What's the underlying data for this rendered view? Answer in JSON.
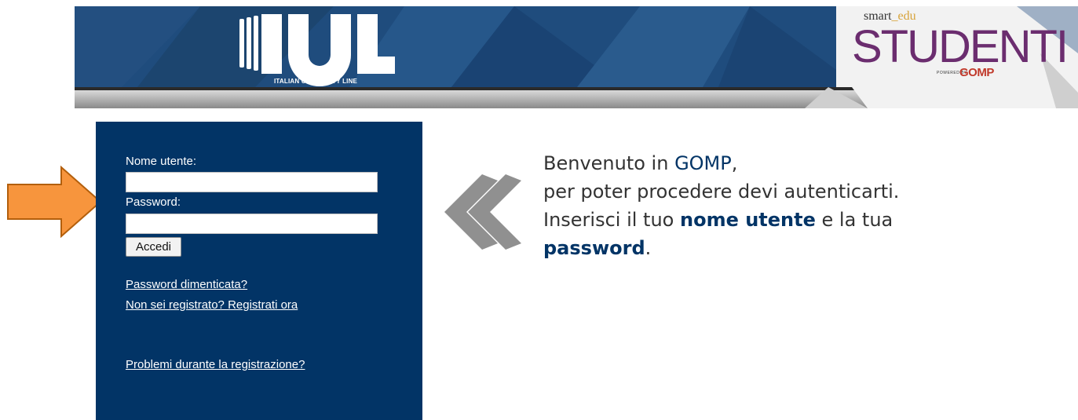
{
  "header": {
    "left_logo_text": "IUL",
    "left_logo_tagline": "ITALIAN UNIVERSITY LINE",
    "right_logo": {
      "smart": "smart",
      "sep": "_",
      "edu": "edu",
      "title": "STUDENTI",
      "powered_by": "POWERED BY",
      "gomp": "GOMP"
    }
  },
  "login": {
    "username_label": "Nome utente:",
    "username_value": "",
    "password_label": "Password:",
    "password_value": "",
    "submit_label": "Accedi",
    "forgot_link": "Password dimenticata?",
    "register_link": "Non sei registrato? Registrati ora",
    "problems_link": "Problemi durante la registrazione?"
  },
  "welcome": {
    "line1_pre": "Benvenuto in ",
    "line1_gomp": "GOMP",
    "line1_post": ",",
    "line2": "per poter procedere devi autenticarti.",
    "line3_pre": "Inserisci il tuo ",
    "line3_bold": "nome utente",
    "line3_post": " e la tua",
    "line4_bold": "password",
    "line4_post": "."
  },
  "colors": {
    "panel": "#023466",
    "banner": "#1f4c7d",
    "arrow": "#f7953d",
    "chevron": "#909090"
  }
}
